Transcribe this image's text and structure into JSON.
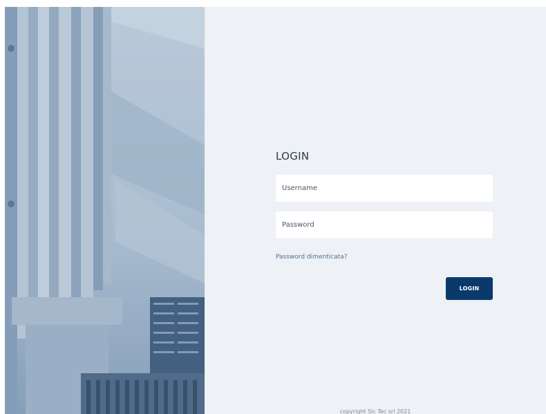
{
  "login": {
    "title": "LOGIN",
    "username_placeholder": "Username",
    "password_placeholder": "Password",
    "forgot_link": "Password dimenticata?",
    "submit_label": "LOGIN"
  },
  "footer": {
    "copyright": "copyright Sic Tec srl 2021"
  },
  "colors": {
    "background": "#eef1f5",
    "button": "#0b3a6a",
    "link": "#4f6e93",
    "input": "#ffffff"
  },
  "icons": {
    "side_image": "industrial-machine-photo"
  }
}
